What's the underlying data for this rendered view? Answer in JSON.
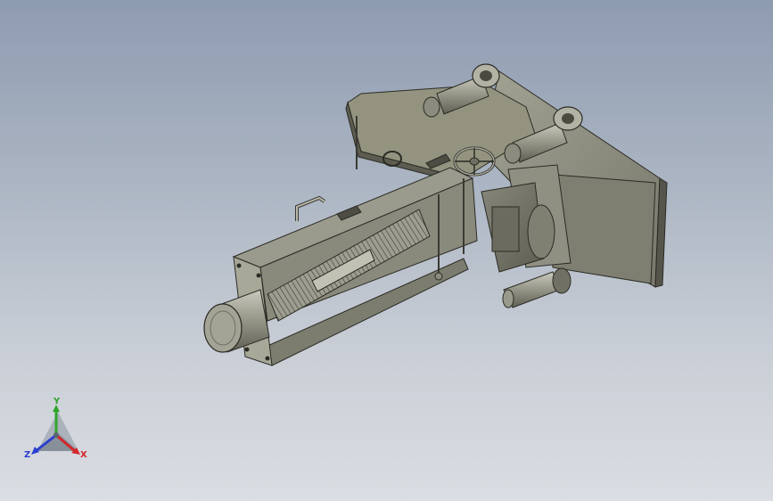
{
  "view": {
    "type": "cad-3d-viewport",
    "background_top": "#8e9bb0",
    "background_bottom": "#dadde2",
    "model_color": "#8a8a7c",
    "edge_color": "#2b2b25"
  },
  "model": {
    "components": [
      "housing-frame-icon",
      "threaded-screw-icon",
      "end-cap-cylinder-icon",
      "handwheel-icon",
      "lifting-eye-icon",
      "mounting-bracket-icon",
      "gearbox-icon",
      "carry-handle-icon"
    ]
  },
  "triad": {
    "x_label": "X",
    "y_label": "Y",
    "z_label": "Z",
    "x_color": "#d2262b",
    "y_color": "#2fa52b",
    "z_color": "#2b3fcf"
  }
}
